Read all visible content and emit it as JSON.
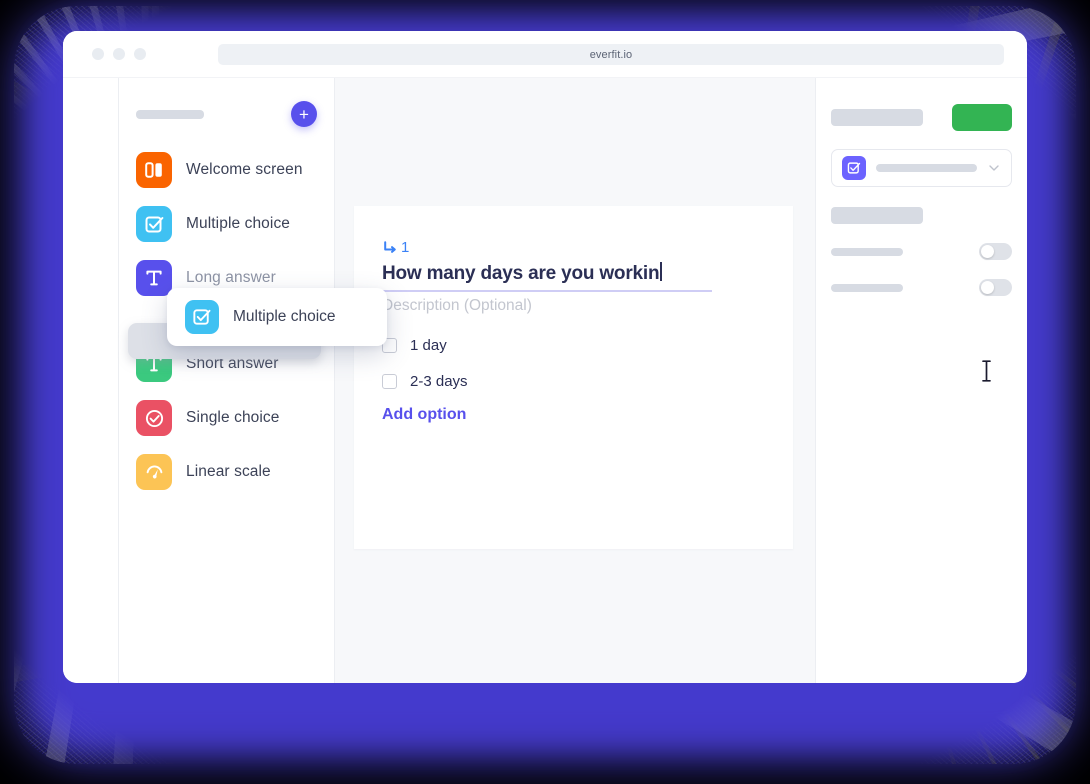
{
  "browser": {
    "url": "everfit.io",
    "traffic_lights": [
      "close",
      "minimize",
      "zoom"
    ]
  },
  "sidebar": {
    "add_button_label": "+",
    "items": [
      {
        "label": "Welcome screen",
        "icon": "welcome-screen-icon",
        "color": "#FA6400",
        "dim": false
      },
      {
        "label": "Multiple choice",
        "icon": "multiple-choice-icon",
        "color": "#3FC1F2",
        "dim": false
      },
      {
        "label": "Long answer",
        "icon": "long-answer-icon",
        "color": "#5850EC",
        "dim": true
      },
      {
        "label": "Short answer",
        "icon": "short-answer-icon",
        "color": "#3BC97F",
        "dim": false
      },
      {
        "label": "Single choice",
        "icon": "single-choice-icon",
        "color": "#EA5164",
        "dim": false
      },
      {
        "label": "Linear scale",
        "icon": "linear-scale-icon",
        "color": "#FCC455",
        "dim": false
      }
    ],
    "drag_card": {
      "label": "Multiple choice",
      "icon": "multiple-choice-icon",
      "color": "#3FC1F2"
    }
  },
  "question": {
    "number": "1",
    "title": "How many days are you workin",
    "description_placeholder": "Description (Optional)",
    "options": [
      {
        "label": "1 day",
        "checked": false
      },
      {
        "label": "2-3 days",
        "checked": false
      }
    ],
    "add_option_label": "Add option"
  },
  "right_panel": {
    "publish_button_label": "",
    "select_value": "",
    "toggles": [
      {
        "label": "",
        "on": false
      },
      {
        "label": "",
        "on": false
      }
    ]
  },
  "colors": {
    "accent": "#5850EC",
    "accent_blue": "#3B82F6",
    "green": "#33B453",
    "text": "#2B2F55",
    "muted": "#8D93A4",
    "glow": "#4F46E5"
  }
}
